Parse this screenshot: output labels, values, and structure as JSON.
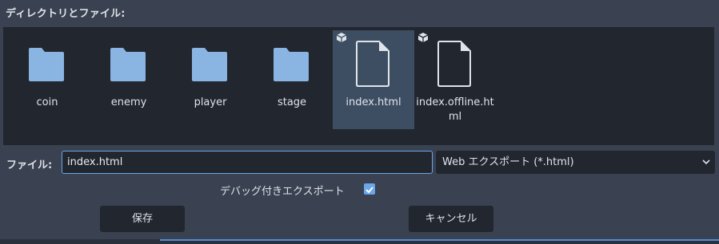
{
  "section_label": "ディレクトリとファイル:",
  "files": [
    {
      "name": "coin",
      "type": "folder",
      "icon": "folder-icon"
    },
    {
      "name": "enemy",
      "type": "folder",
      "icon": "folder-icon"
    },
    {
      "name": "player",
      "type": "folder",
      "icon": "folder-icon"
    },
    {
      "name": "stage",
      "type": "folder",
      "icon": "folder-icon"
    },
    {
      "name": "index.html",
      "type": "file",
      "icon": "file-icon",
      "selected": true
    },
    {
      "name": "index.offline.html",
      "type": "file",
      "icon": "file-icon"
    }
  ],
  "file_row": {
    "label": "ファイル:",
    "value": "index.html",
    "filter": "Web エクスポート (*.html)"
  },
  "debug": {
    "label": "デバッグ付きエクスポート",
    "checked": true
  },
  "buttons": {
    "save": "保存",
    "cancel": "キャンセル"
  },
  "colors": {
    "background": "#3a4150",
    "panel": "#21262f",
    "selected_tile": "#3d4e63",
    "accent": "#6aa6e8",
    "folder": "#8ab4e2",
    "file_outline": "#dfe3ea"
  }
}
